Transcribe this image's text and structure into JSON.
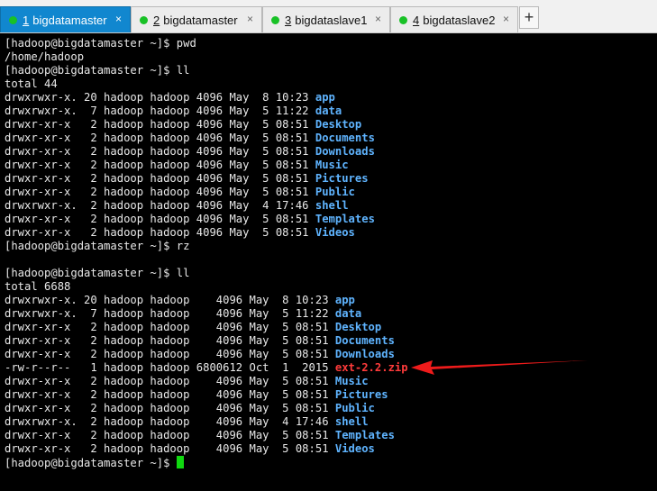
{
  "tabs": [
    {
      "number": "1",
      "label": "bigdatamaster",
      "active": true
    },
    {
      "number": "2",
      "label": "bigdatamaster",
      "active": false
    },
    {
      "number": "3",
      "label": "bigdataslave1",
      "active": false
    },
    {
      "number": "4",
      "label": "bigdataslave2",
      "active": false
    }
  ],
  "new_tab_label": "+",
  "close_glyph": "×",
  "colors": {
    "tab_active": "#1187cf",
    "status_dot": "#18c126",
    "dir_color": "#5fb4ff",
    "zip_color": "#ff3b3b",
    "cursor": "#10d810",
    "arrow": "#ee1b1b"
  },
  "terminal": {
    "lines": [
      {
        "text": "[hadoop@bigdatamaster ~]$ pwd"
      },
      {
        "text": "/home/hadoop"
      },
      {
        "text": "[hadoop@bigdatamaster ~]$ ll"
      },
      {
        "text": "total 44"
      },
      {
        "text": "drwxrwxr-x. 20 hadoop hadoop 4096 May  8 10:23 ",
        "name": "app",
        "type": "dir"
      },
      {
        "text": "drwxrwxr-x.  7 hadoop hadoop 4096 May  5 11:22 ",
        "name": "data",
        "type": "dir"
      },
      {
        "text": "drwxr-xr-x   2 hadoop hadoop 4096 May  5 08:51 ",
        "name": "Desktop",
        "type": "dir"
      },
      {
        "text": "drwxr-xr-x   2 hadoop hadoop 4096 May  5 08:51 ",
        "name": "Documents",
        "type": "dir"
      },
      {
        "text": "drwxr-xr-x   2 hadoop hadoop 4096 May  5 08:51 ",
        "name": "Downloads",
        "type": "dir"
      },
      {
        "text": "drwxr-xr-x   2 hadoop hadoop 4096 May  5 08:51 ",
        "name": "Music",
        "type": "dir"
      },
      {
        "text": "drwxr-xr-x   2 hadoop hadoop 4096 May  5 08:51 ",
        "name": "Pictures",
        "type": "dir"
      },
      {
        "text": "drwxr-xr-x   2 hadoop hadoop 4096 May  5 08:51 ",
        "name": "Public",
        "type": "dir"
      },
      {
        "text": "drwxrwxr-x.  2 hadoop hadoop 4096 May  4 17:46 ",
        "name": "shell",
        "type": "dir"
      },
      {
        "text": "drwxr-xr-x   2 hadoop hadoop 4096 May  5 08:51 ",
        "name": "Templates",
        "type": "dir"
      },
      {
        "text": "drwxr-xr-x   2 hadoop hadoop 4096 May  5 08:51 ",
        "name": "Videos",
        "type": "dir"
      },
      {
        "text": "[hadoop@bigdatamaster ~]$ rz"
      },
      {
        "text": ""
      },
      {
        "text": "[hadoop@bigdatamaster ~]$ ll"
      },
      {
        "text": "total 6688"
      },
      {
        "text": "drwxrwxr-x. 20 hadoop hadoop    4096 May  8 10:23 ",
        "name": "app",
        "type": "dir"
      },
      {
        "text": "drwxrwxr-x.  7 hadoop hadoop    4096 May  5 11:22 ",
        "name": "data",
        "type": "dir"
      },
      {
        "text": "drwxr-xr-x   2 hadoop hadoop    4096 May  5 08:51 ",
        "name": "Desktop",
        "type": "dir"
      },
      {
        "text": "drwxr-xr-x   2 hadoop hadoop    4096 May  5 08:51 ",
        "name": "Documents",
        "type": "dir"
      },
      {
        "text": "drwxr-xr-x   2 hadoop hadoop    4096 May  5 08:51 ",
        "name": "Downloads",
        "type": "dir"
      },
      {
        "text": "-rw-r--r--   1 hadoop hadoop 6800612 Oct  1  2015 ",
        "name": "ext-2.2.zip",
        "type": "zip"
      },
      {
        "text": "drwxr-xr-x   2 hadoop hadoop    4096 May  5 08:51 ",
        "name": "Music",
        "type": "dir"
      },
      {
        "text": "drwxr-xr-x   2 hadoop hadoop    4096 May  5 08:51 ",
        "name": "Pictures",
        "type": "dir"
      },
      {
        "text": "drwxr-xr-x   2 hadoop hadoop    4096 May  5 08:51 ",
        "name": "Public",
        "type": "dir"
      },
      {
        "text": "drwxrwxr-x.  2 hadoop hadoop    4096 May  4 17:46 ",
        "name": "shell",
        "type": "dir"
      },
      {
        "text": "drwxr-xr-x   2 hadoop hadoop    4096 May  5 08:51 ",
        "name": "Templates",
        "type": "dir"
      },
      {
        "text": "drwxr-xr-x   2 hadoop hadoop    4096 May  5 08:51 ",
        "name": "Videos",
        "type": "dir"
      },
      {
        "text": "[hadoop@bigdatamaster ~]$ ",
        "cursor": true
      }
    ]
  }
}
